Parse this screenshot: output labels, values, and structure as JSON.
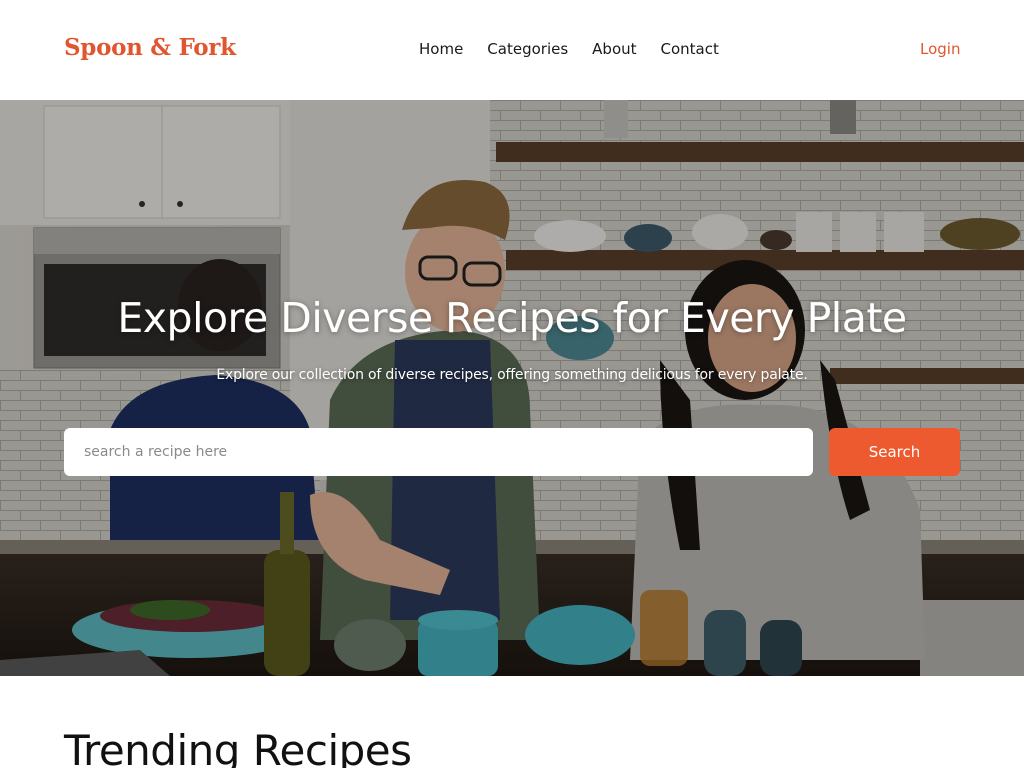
{
  "brand": {
    "name": "Spoon & Fork",
    "accent": "#e0562f"
  },
  "nav": {
    "items": [
      "Home",
      "Categories",
      "About",
      "Contact"
    ],
    "login_label": "Login"
  },
  "hero": {
    "title": "Explore Diverse Recipes for Every Plate",
    "subtitle": "Explore our collection of diverse recipes, offering something delicious for every palate.",
    "search": {
      "placeholder": "search a recipe here",
      "value": "",
      "button_label": "Search",
      "button_color": "#ee5a2f"
    },
    "image": "photo of a man and a woman cooking together in a kitchen"
  },
  "trending": {
    "title": "Trending Recipes"
  }
}
